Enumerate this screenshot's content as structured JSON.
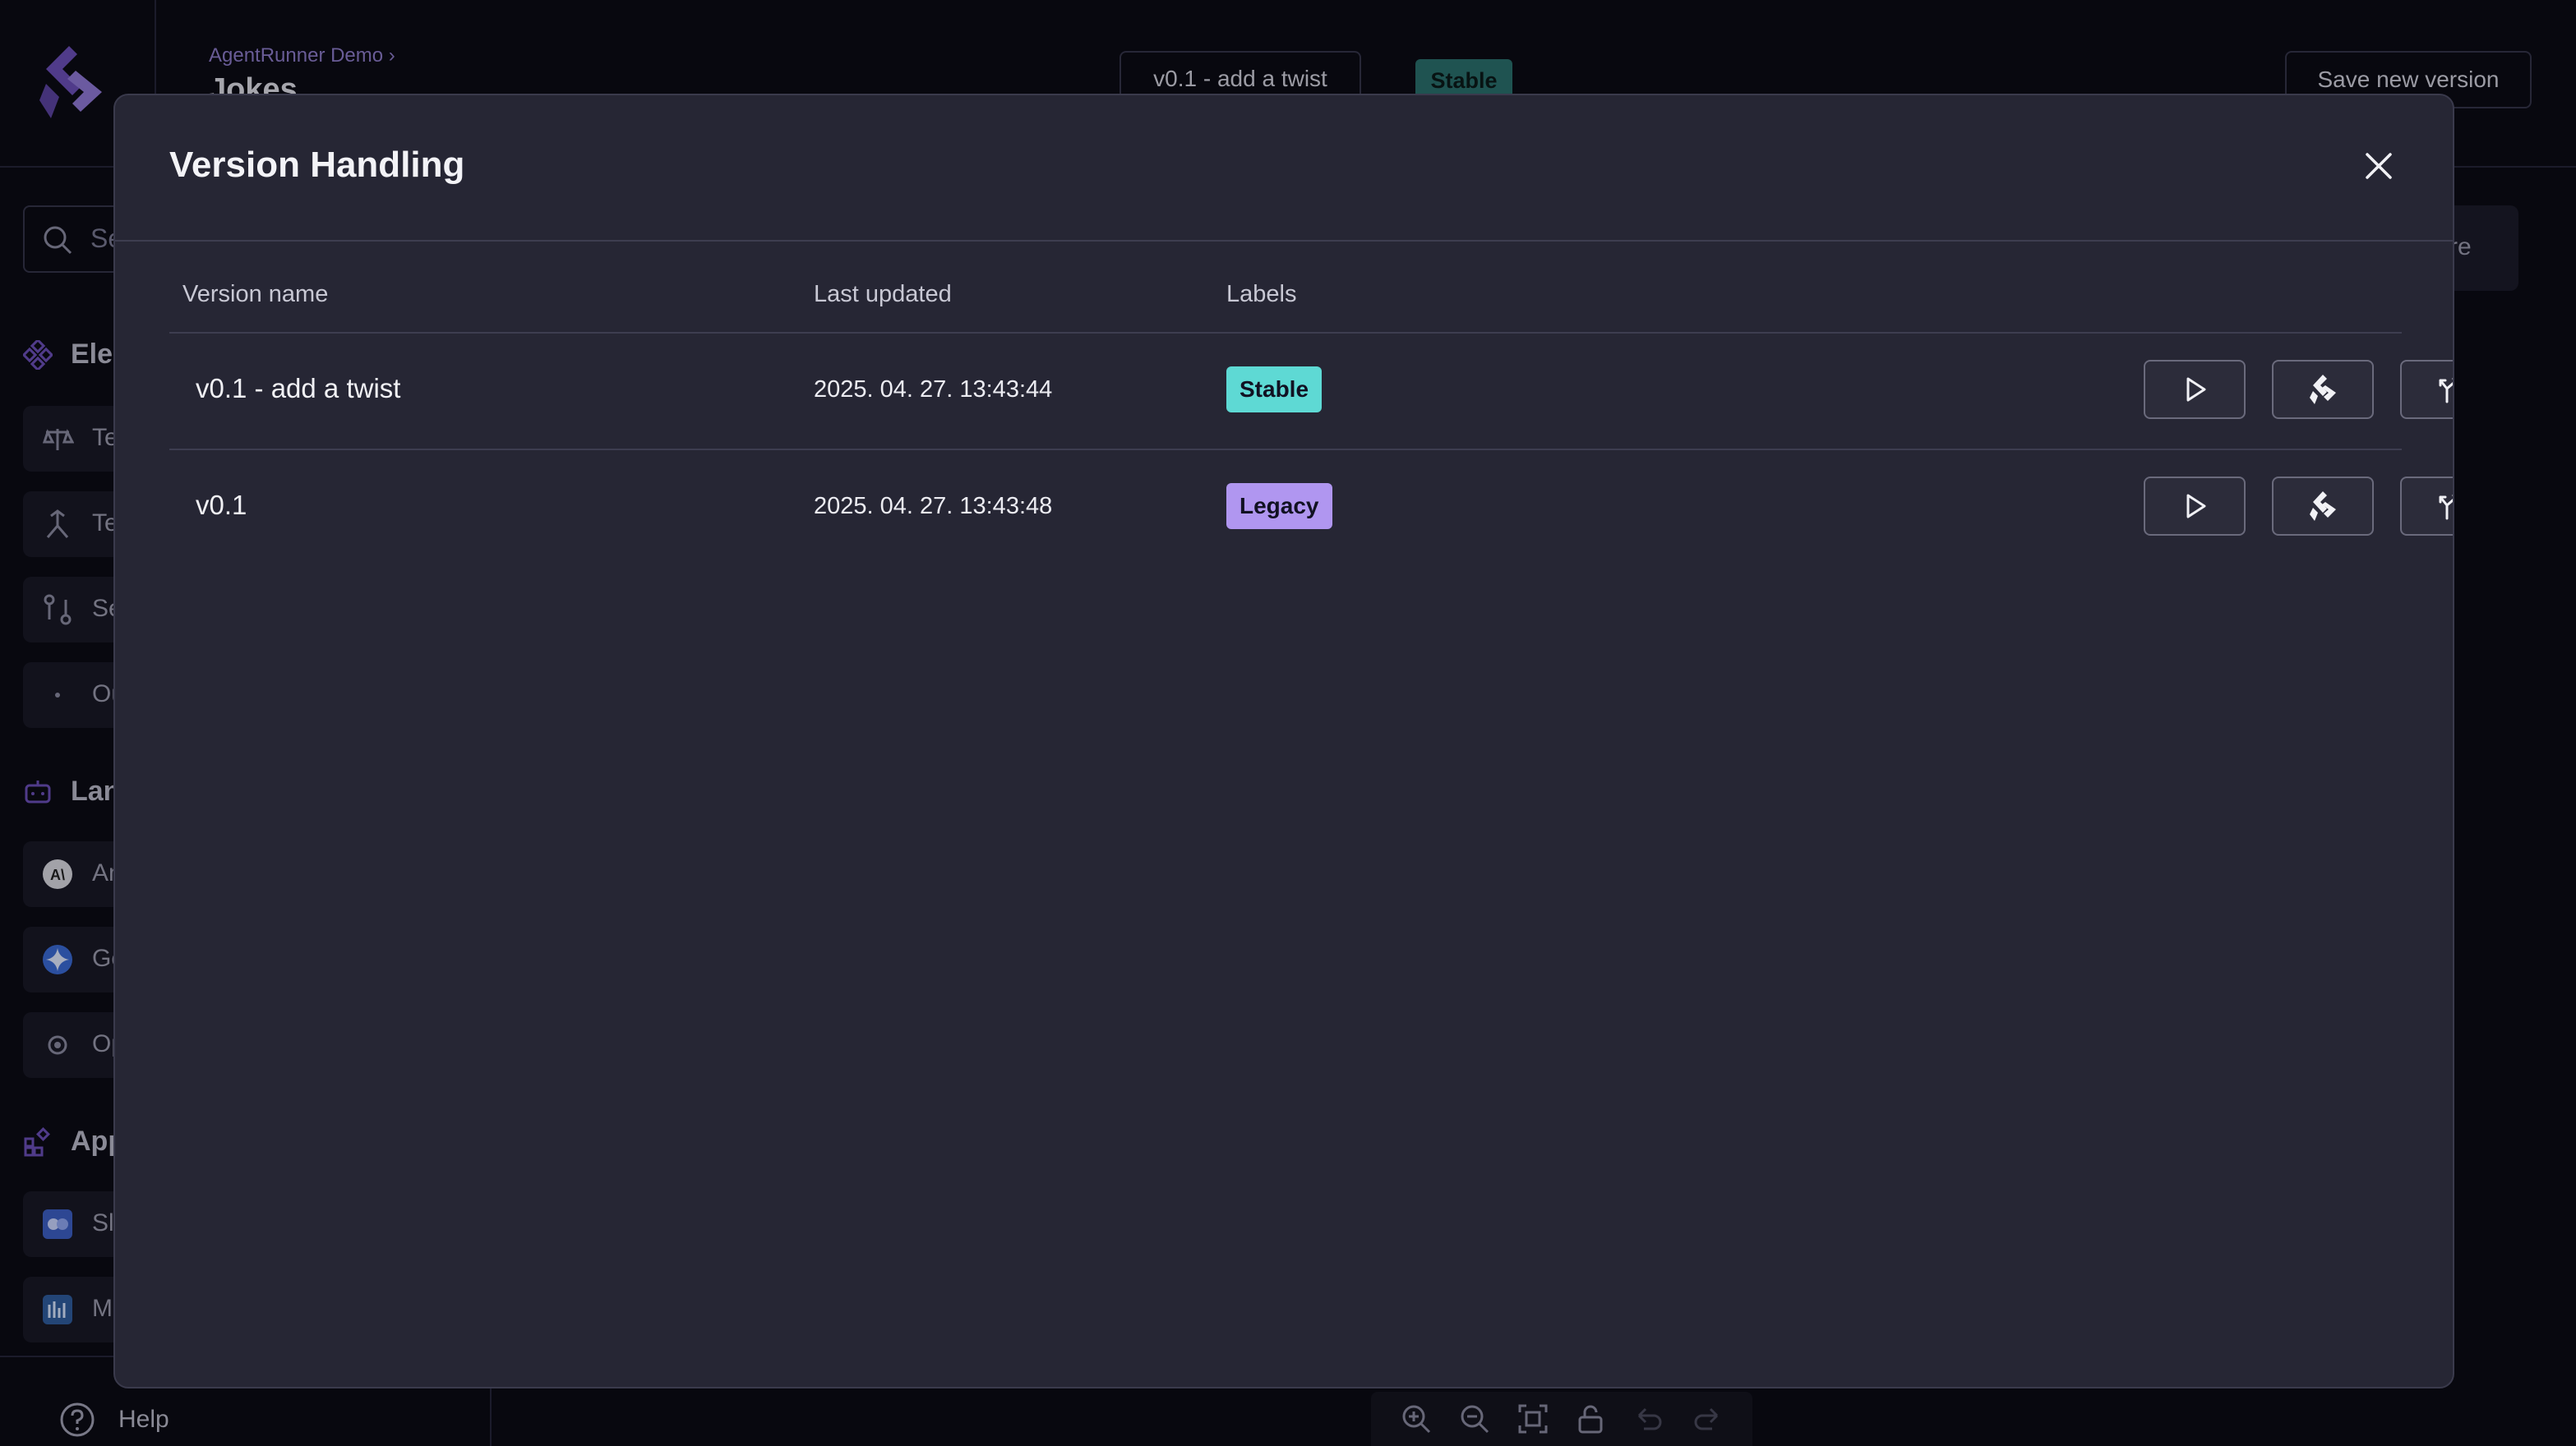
{
  "header": {
    "breadcrumb": "AgentRunner Demo ›",
    "page_title": "Jokes",
    "current_version": "v0.1 - add a twist",
    "current_label": "Stable",
    "save_button": "Save new version"
  },
  "sidebar": {
    "search_placeholder": "Se",
    "sections": [
      {
        "title": "Ele",
        "items": [
          "Te",
          "Te",
          "Se",
          "Ou"
        ]
      },
      {
        "title": "Lan",
        "items": [
          "An",
          "Ge",
          "Op"
        ]
      },
      {
        "title": "App",
        "items": [
          "Sl",
          "M"
        ]
      }
    ],
    "help": "Help"
  },
  "right_panel": {
    "button_label": "re"
  },
  "modal": {
    "title": "Version Handling",
    "columns": [
      "Version name",
      "Last updated",
      "Labels"
    ],
    "rows": [
      {
        "name": "v0.1 - add a twist",
        "updated": "2025. 04. 27. 13:43:44",
        "label": "Stable",
        "label_color": "#5ed9d4"
      },
      {
        "name": "v0.1",
        "updated": "2025. 04. 27. 13:43:48",
        "label": "Legacy",
        "label_color": "#b096f0"
      }
    ],
    "row_actions": [
      "play-icon",
      "agent-logo-icon",
      "branch-icon"
    ]
  },
  "colors": {
    "brand": "#6b4fb8",
    "stable": "#5ed9d4",
    "legacy": "#b096f0"
  }
}
